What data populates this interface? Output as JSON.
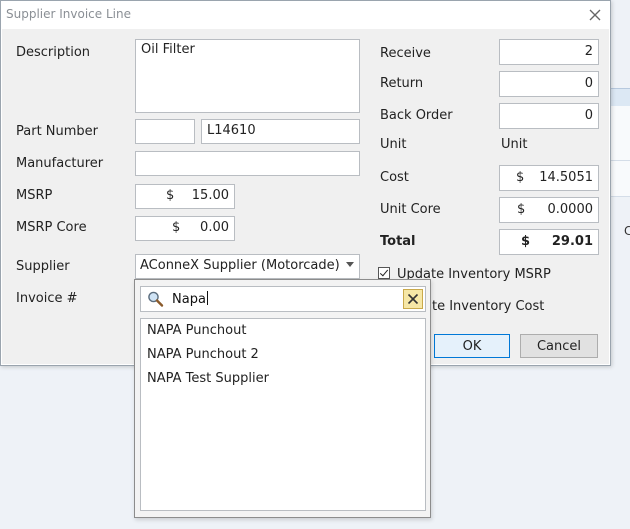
{
  "dialog": {
    "title": "Supplier Invoice Line",
    "close_icon": "close-icon"
  },
  "left": {
    "description_label": "Description",
    "description_value": "Oil Filter",
    "part_number_label": "Part Number",
    "part_prefix_value": "",
    "part_number_value": "L14610",
    "manufacturer_label": "Manufacturer",
    "manufacturer_value": "",
    "msrp_label": "MSRP",
    "msrp_currency": "$",
    "msrp_value": "15.00",
    "msrp_core_label": "MSRP Core",
    "msrp_core_currency": "$",
    "msrp_core_value": "0.00",
    "supplier_label": "Supplier",
    "supplier_value": "AConneX Supplier (Motorcade)",
    "invoice_label": "Invoice #"
  },
  "right": {
    "receive_label": "Receive",
    "receive_value": "2",
    "return_label": "Return",
    "return_value": "0",
    "back_order_label": "Back Order",
    "back_order_value": "0",
    "unit_label": "Unit",
    "unit_value": "Unit",
    "cost_label": "Cost",
    "cost_currency": "$",
    "cost_value": "14.5051",
    "unit_core_label": "Unit Core",
    "unit_core_currency": "$",
    "unit_core_value": "0.0000",
    "total_label": "Total",
    "total_currency": "$",
    "total_value": "29.01",
    "update_msrp_label": "Update Inventory MSRP",
    "update_msrp_checked": true,
    "update_cost_label_visible": "te Inventory Cost",
    "ok_label": "OK",
    "cancel_label": "Cancel"
  },
  "supplier_popup": {
    "search_value": "Napa",
    "search_icon": "magnifier-icon",
    "clear_icon": "clear-x-icon",
    "results": [
      "NAPA Punchout",
      "NAPA Punchout 2",
      "NAPA Test Supplier"
    ]
  },
  "colors": {
    "primary_button_border": "#0078d7",
    "clear_button_bg": "#f6e7a6"
  }
}
